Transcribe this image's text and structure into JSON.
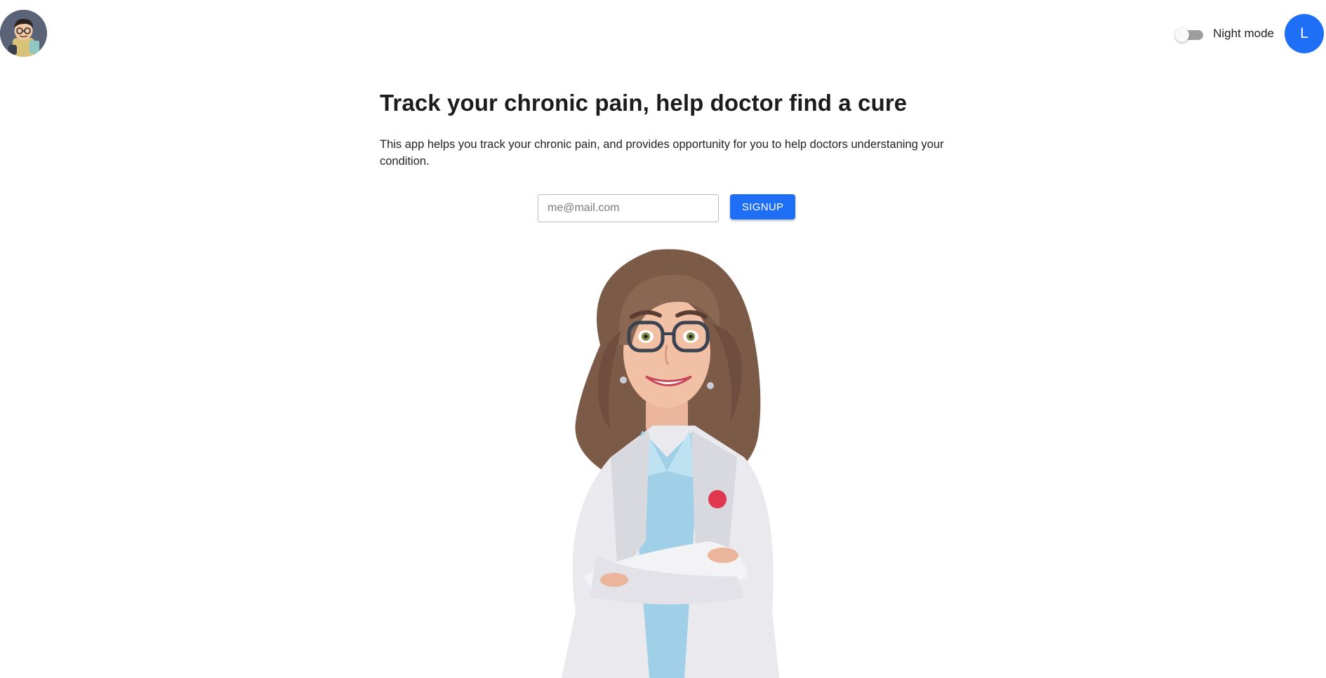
{
  "header": {
    "logo_icon": "cartoon-avatar-logo",
    "night_mode_label": "Night mode",
    "night_mode_on": false,
    "user_initial": "L",
    "user_avatar_color": "#1e6ff5"
  },
  "main": {
    "headline": "Track your chronic pain, help doctor find a cure",
    "intro": "This app helps you track your chronic pain, and provides opportunity for you to help doctors understaning your condition.",
    "signup": {
      "email_placeholder": "me@mail.com",
      "email_value": "",
      "button_label": "SIGNUP",
      "button_color": "#1e6ff5"
    },
    "hero_icon": "doctor-illustration"
  }
}
